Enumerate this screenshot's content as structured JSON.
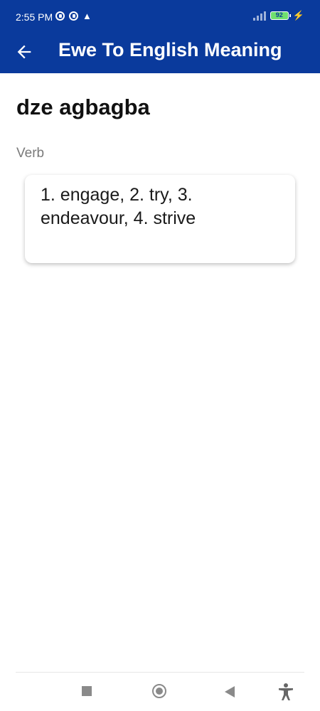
{
  "status_bar": {
    "time": "2:55 PM",
    "battery": "92",
    "icons": [
      "data-saver-icon",
      "data-saver-icon",
      "warning-icon",
      "signal-icon",
      "battery-icon",
      "charging-icon"
    ]
  },
  "header": {
    "title": "Ewe To English Meaning",
    "back_icon": "arrow-left-icon",
    "background_color": "#0a3a9c"
  },
  "entry": {
    "word": "dze agbagba",
    "part_of_speech": "Verb",
    "meaning": "1. engage, 2. try, 3. endeavour, 4. strive"
  },
  "nav_bar": {
    "buttons": [
      "recents-icon",
      "home-icon",
      "back-icon",
      "accessibility-icon"
    ]
  }
}
